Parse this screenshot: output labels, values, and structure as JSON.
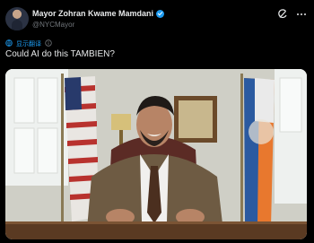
{
  "author": {
    "display_name": "Mayor Zohran Kwame Mamdani",
    "handle": "@NYCMayor",
    "verified": true
  },
  "translate": {
    "label": "显示翻译",
    "icon": "globe-icon",
    "info_icon": "info-icon"
  },
  "tweet": {
    "text": "Could AI do this TAMBIEN?"
  },
  "top_actions": [
    {
      "name": "grok-icon"
    },
    {
      "name": "more-icon"
    }
  ],
  "colors": {
    "background": "#000000",
    "link": "#1d9bf0",
    "secondary_text": "#71767b"
  }
}
